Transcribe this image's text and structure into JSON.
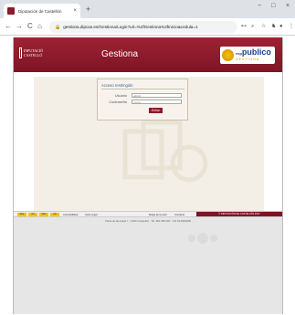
{
  "browser": {
    "tab_title": "Diputación de Castellón",
    "tab_close": "×",
    "new_tab": "+",
    "win_minimize": "−",
    "win_maximize": "□",
    "win_close": "×",
    "url": "gestiona.dipcas.es/Gestiona/Login?url=%2fGestiona%2fInicio&cedula=1",
    "back": "←",
    "forward": "→",
    "reload": "C",
    "home": "⌂",
    "lock": "🔒",
    "key": "⊷",
    "zoom": "⌕",
    "star": "☆",
    "extensions": "♞",
    "profile": "●",
    "menu": "⋮"
  },
  "site": {
    "logo_left_text": "DIPUTACIÓ CASTELLÓ",
    "title": "Gestiona",
    "logo_right_prefix": "esp",
    "logo_right_main": "publico",
    "logo_right_sub": "GESTIONA"
  },
  "login": {
    "title": "Acceso restringido",
    "user_label": "Usuario",
    "user_value": "admin",
    "password_label": "Contraseña",
    "password_value": "••••••••",
    "submit_label": "Entrar"
  },
  "footer": {
    "badges": [
      "WAI",
      "AA",
      "WAI",
      "AA"
    ],
    "accessibility": "Accesibilidad",
    "legal": "Aviso legal",
    "sitemap": "Mapa de la web",
    "contact": "Contacto",
    "copyright": "© DIPUTACIÓN DE CASTELLÓN 2017",
    "address": "Plaza de las Aulas 7 · 12001 Castellón · Tel. 964 359 600 · CIF P1200000B"
  },
  "colors": {
    "brand": "#8a1b2a",
    "brand_dark": "#7d1525",
    "accent": "#f5c400",
    "panel": "#f3efe7"
  }
}
